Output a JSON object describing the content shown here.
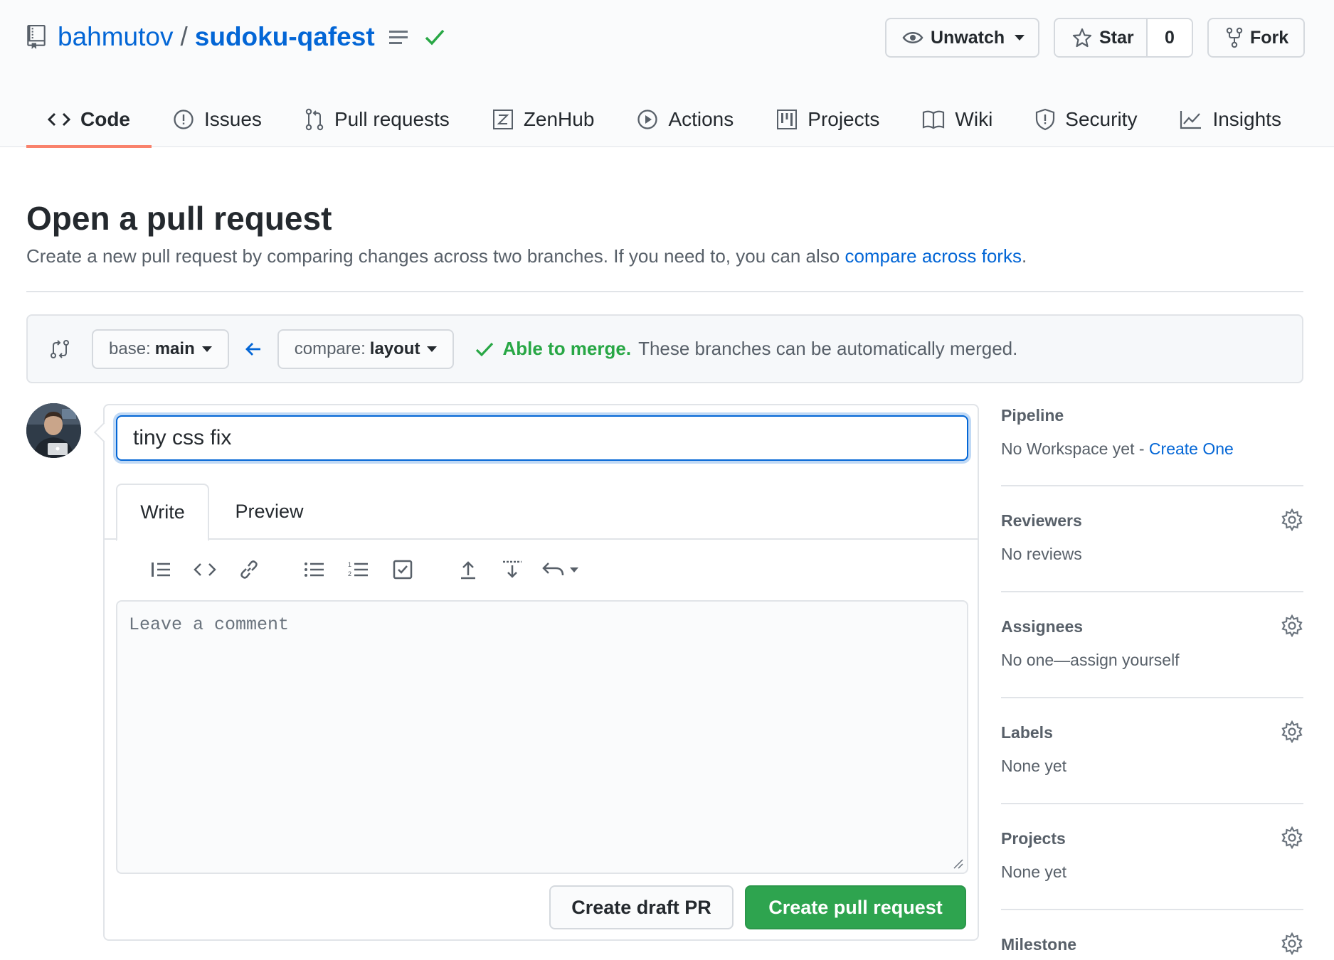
{
  "repo": {
    "owner": "bahmutov",
    "separator": "/",
    "name": "sudoku-qafest"
  },
  "actions": {
    "unwatch_label": "Unwatch",
    "star_label": "Star",
    "star_count": "0",
    "fork_label": "Fork"
  },
  "nav": {
    "code": "Code",
    "issues": "Issues",
    "pull_requests": "Pull requests",
    "zenhub": "ZenHub",
    "actions": "Actions",
    "projects": "Projects",
    "wiki": "Wiki",
    "security": "Security",
    "insights": "Insights"
  },
  "page": {
    "title": "Open a pull request",
    "description": "Create a new pull request by comparing changes across two branches. If you need to, you can also ",
    "description_link": "compare across forks",
    "description_end": "."
  },
  "range": {
    "base_prefix": "base:",
    "base_ref": "main",
    "compare_prefix": "compare:",
    "compare_ref": "layout",
    "merge_ok": "Able to merge.",
    "merge_text": "These branches can be automatically merged."
  },
  "compose": {
    "title_value": "tiny css fix",
    "tab_write": "Write",
    "tab_preview": "Preview",
    "comment_placeholder": "Leave a comment",
    "draft_button": "Create draft PR",
    "create_button": "Create pull request"
  },
  "sidebar": {
    "pipeline_heading": "Pipeline",
    "pipeline_text": "No Workspace yet - ",
    "pipeline_link": "Create One",
    "reviewers_heading": "Reviewers",
    "reviewers_value": "No reviews",
    "assignees_heading": "Assignees",
    "assignees_value": "No one—assign yourself",
    "labels_heading": "Labels",
    "labels_value": "None yet",
    "projects_heading": "Projects",
    "projects_value": "None yet",
    "milestone_heading": "Milestone"
  },
  "colors": {
    "link": "#0366d6",
    "success": "#28a745",
    "primary_button": "#2ea44f",
    "selected_tab_underline": "#f9826c"
  }
}
